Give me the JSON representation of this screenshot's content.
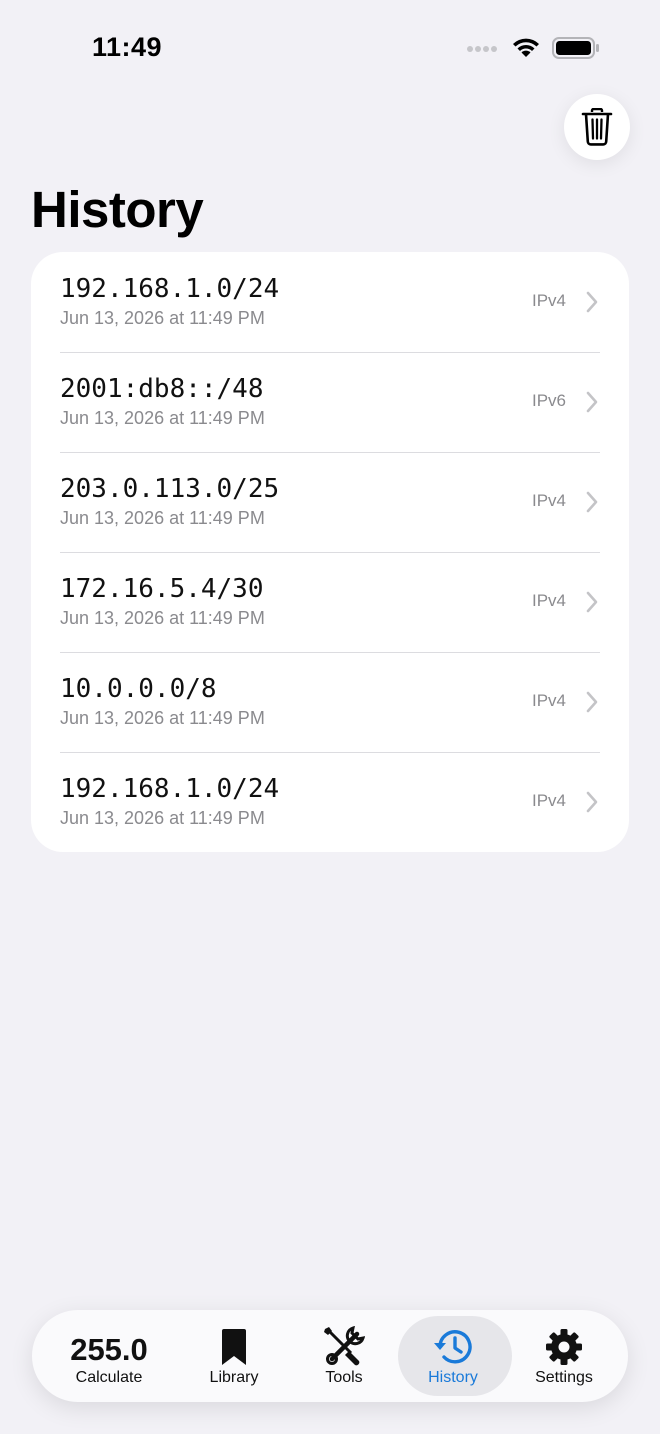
{
  "status_bar": {
    "time": "11:49"
  },
  "page": {
    "title": "History"
  },
  "history": [
    {
      "cidr": "192.168.1.0/24",
      "date": "Jun 13, 2026 at 11:49 PM",
      "type": "IPv4"
    },
    {
      "cidr": "2001:db8::/48",
      "date": "Jun 13, 2026 at 11:49 PM",
      "type": "IPv6"
    },
    {
      "cidr": "203.0.113.0/25",
      "date": "Jun 13, 2026 at 11:49 PM",
      "type": "IPv4"
    },
    {
      "cidr": "172.16.5.4/30",
      "date": "Jun 13, 2026 at 11:49 PM",
      "type": "IPv4"
    },
    {
      "cidr": "10.0.0.0/8",
      "date": "Jun 13, 2026 at 11:49 PM",
      "type": "IPv4"
    },
    {
      "cidr": "192.168.1.0/24",
      "date": "Jun 13, 2026 at 11:49 PM",
      "type": "IPv4"
    }
  ],
  "tab_bar": {
    "active": "History",
    "accent_color": "#1a7ad9",
    "tabs": [
      {
        "label": "Calculate",
        "value": "255.0",
        "icon": "calculate-value"
      },
      {
        "label": "Library",
        "icon": "bookmark-icon"
      },
      {
        "label": "Tools",
        "icon": "tools-icon"
      },
      {
        "label": "History",
        "icon": "history-clock-icon"
      },
      {
        "label": "Settings",
        "icon": "gear-icon"
      }
    ]
  },
  "toolbar": {
    "trash_icon": "trash-icon"
  }
}
